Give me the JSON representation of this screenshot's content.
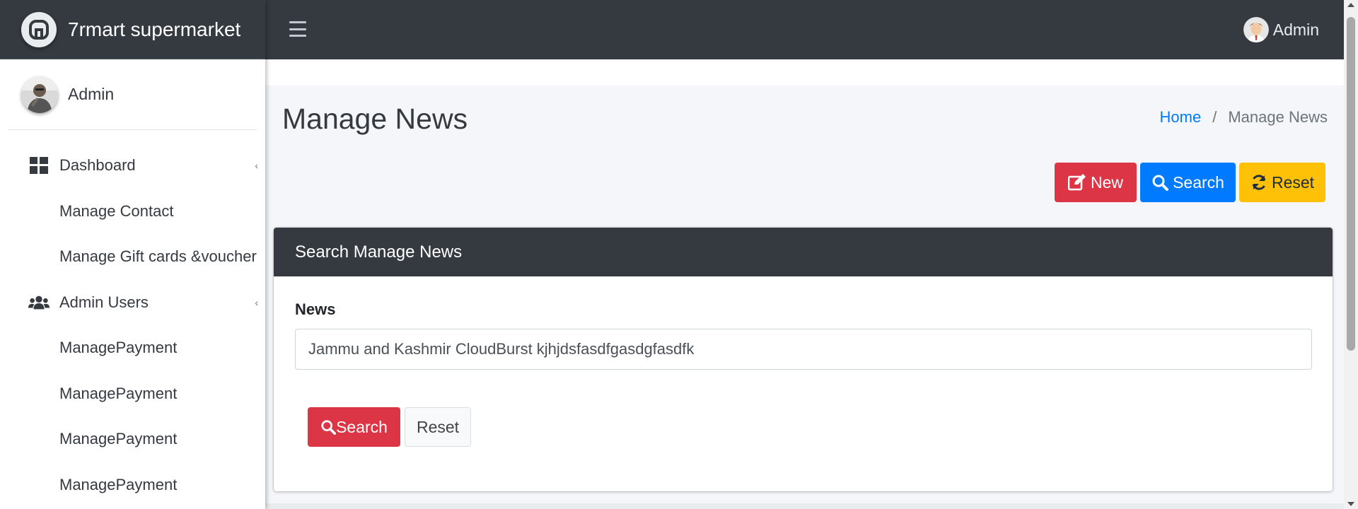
{
  "brand": {
    "name": "7rmart supermarket",
    "logo_icon": "brand-logo-icon"
  },
  "sidebar": {
    "user_name": "Admin",
    "items": [
      {
        "label": "Dashboard",
        "icon": "dashboard-icon",
        "has_caret": true
      },
      {
        "label": "Manage Contact"
      },
      {
        "label": "Manage Gift cards &voucher"
      },
      {
        "label": "Admin Users",
        "icon": "users-icon",
        "has_caret": true
      },
      {
        "label": "ManagePayment"
      },
      {
        "label": "ManagePayment"
      },
      {
        "label": "ManagePayment"
      },
      {
        "label": "ManagePayment"
      }
    ]
  },
  "topbar": {
    "menu_icon": "hamburger-icon",
    "user_name": "Admin"
  },
  "page": {
    "title": "Manage News",
    "breadcrumb": {
      "home": "Home",
      "separator": "/",
      "current": "Manage News"
    }
  },
  "toolbar": {
    "new_label": "New",
    "search_label": "Search",
    "reset_label": "Reset"
  },
  "search_card": {
    "title": "Search Manage News",
    "field_label": "News",
    "field_value": "Jammu and Kashmir CloudBurst kjhjdsfasdfgasdgfasdfk",
    "search_button": "Search",
    "reset_button": "Reset"
  },
  "colors": {
    "dark": "#343a40",
    "primary": "#007bff",
    "danger": "#dc3545",
    "warning": "#ffc107",
    "background": "#f4f6f9"
  }
}
